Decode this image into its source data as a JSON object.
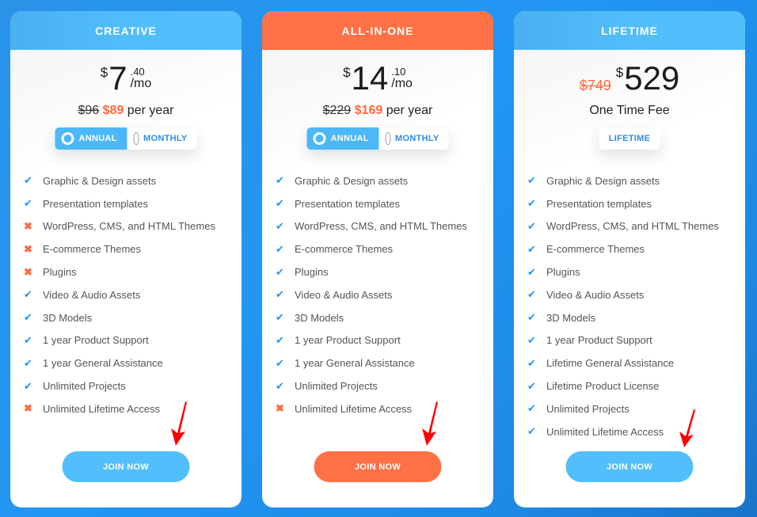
{
  "colors": {
    "background": "#2196f3",
    "accent_blue": "#52bdfb",
    "accent_orange": "#ff7146",
    "check": "#2196f3",
    "cross": "#ff6a3d",
    "annotation_arrow": "#ff0000"
  },
  "plans": [
    {
      "name": "CREATIVE",
      "header_color": "blue",
      "price": {
        "currency": "$",
        "amount": "7",
        "cents": ".40",
        "period": "/mo"
      },
      "yearly": {
        "old": "$96",
        "new": "$89",
        "suffix": "per year"
      },
      "billing_toggle": {
        "options": [
          "ANNUAL",
          "MONTHLY"
        ],
        "selected": "ANNUAL"
      },
      "features": [
        {
          "label": "Graphic & Design assets",
          "included": true,
          "icon": "check-icon"
        },
        {
          "label": "Presentation templates",
          "included": true,
          "icon": "check-icon"
        },
        {
          "label": "WordPress, CMS, and HTML Themes",
          "included": false,
          "icon": "cross-icon"
        },
        {
          "label": "E-commerce Themes",
          "included": false,
          "icon": "cross-icon"
        },
        {
          "label": "Plugins",
          "included": false,
          "icon": "cross-icon"
        },
        {
          "label": "Video & Audio Assets",
          "included": true,
          "icon": "check-icon"
        },
        {
          "label": "3D Models",
          "included": true,
          "icon": "check-icon"
        },
        {
          "label": "1 year Product Support",
          "included": true,
          "icon": "check-icon"
        },
        {
          "label": "1 year General Assistance",
          "included": true,
          "icon": "check-icon"
        },
        {
          "label": "Unlimited Projects",
          "included": true,
          "icon": "check-icon"
        },
        {
          "label": "Unlimited Lifetime Access",
          "included": false,
          "icon": "cross-icon"
        }
      ],
      "cta": "JOIN NOW"
    },
    {
      "name": "ALL-IN-ONE",
      "header_color": "orange",
      "price": {
        "currency": "$",
        "amount": "14",
        "cents": ".10",
        "period": "/mo"
      },
      "yearly": {
        "old": "$229",
        "new": "$169",
        "suffix": "per year"
      },
      "billing_toggle": {
        "options": [
          "ANNUAL",
          "MONTHLY"
        ],
        "selected": "ANNUAL"
      },
      "features": [
        {
          "label": "Graphic & Design assets",
          "included": true,
          "icon": "check-icon"
        },
        {
          "label": "Presentation templates",
          "included": true,
          "icon": "check-icon"
        },
        {
          "label": "WordPress, CMS, and HTML Themes",
          "included": true,
          "icon": "check-icon"
        },
        {
          "label": "E-commerce Themes",
          "included": true,
          "icon": "check-icon"
        },
        {
          "label": "Plugins",
          "included": true,
          "icon": "check-icon"
        },
        {
          "label": "Video & Audio Assets",
          "included": true,
          "icon": "check-icon"
        },
        {
          "label": "3D Models",
          "included": true,
          "icon": "check-icon"
        },
        {
          "label": "1 year Product Support",
          "included": true,
          "icon": "check-icon"
        },
        {
          "label": "1 year General Assistance",
          "included": true,
          "icon": "check-icon"
        },
        {
          "label": "Unlimited Projects",
          "included": true,
          "icon": "check-icon"
        },
        {
          "label": "Unlimited Lifetime Access",
          "included": false,
          "icon": "cross-icon"
        }
      ],
      "cta": "JOIN NOW"
    },
    {
      "name": "LIFETIME",
      "header_color": "blue",
      "price": {
        "old": "$749",
        "currency": "$",
        "amount": "529"
      },
      "subtitle": "One Time Fee",
      "badge": "LIFETIME",
      "features": [
        {
          "label": "Graphic & Design assets",
          "included": true,
          "icon": "check-icon"
        },
        {
          "label": "Presentation templates",
          "included": true,
          "icon": "check-icon"
        },
        {
          "label": "WordPress, CMS, and HTML Themes",
          "included": true,
          "icon": "check-icon"
        },
        {
          "label": "E-commerce Themes",
          "included": true,
          "icon": "check-icon"
        },
        {
          "label": "Plugins",
          "included": true,
          "icon": "check-icon"
        },
        {
          "label": "Video & Audio Assets",
          "included": true,
          "icon": "check-icon"
        },
        {
          "label": "3D Models",
          "included": true,
          "icon": "check-icon"
        },
        {
          "label": "1 year Product Support",
          "included": true,
          "icon": "check-icon"
        },
        {
          "label": "Lifetime General Assistance",
          "included": true,
          "icon": "check-icon"
        },
        {
          "label": "Lifetime Product License",
          "included": true,
          "icon": "check-icon"
        },
        {
          "label": "Unlimited Projects",
          "included": true,
          "icon": "check-icon"
        },
        {
          "label": "Unlimited Lifetime Access",
          "included": true,
          "icon": "check-icon"
        }
      ],
      "cta": "JOIN NOW"
    }
  ],
  "icons": {
    "check": "✔",
    "cross": "✖"
  }
}
